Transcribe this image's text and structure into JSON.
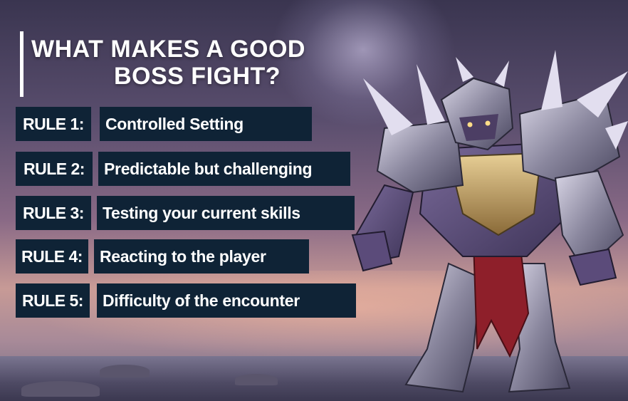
{
  "title": {
    "line1": "WHAT MAKES A GOOD",
    "line2": "BOSS FIGHT?"
  },
  "rules": [
    {
      "label": "RULE 1:",
      "text": "Controlled Setting"
    },
    {
      "label": "RULE 2:",
      "text": "Predictable but challenging"
    },
    {
      "label": "RULE 3:",
      "text": "Testing your current skills"
    },
    {
      "label": "RULE 4:",
      "text": "Reacting to the player"
    },
    {
      "label": "RULE 5:",
      "text": "Difficulty of the encounter"
    }
  ],
  "colors": {
    "box_background": "#0f2336",
    "text": "#ffffff"
  },
  "illustration": {
    "icon": "armored-boss-warrior-icon"
  }
}
